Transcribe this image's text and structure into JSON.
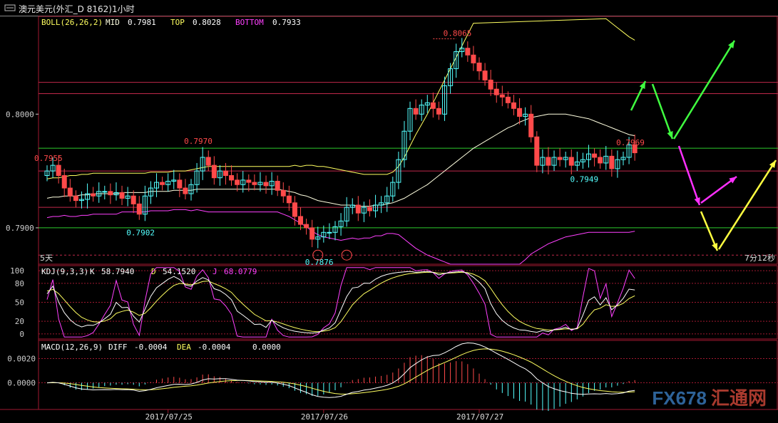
{
  "window": {
    "title": "澳元美元(外汇_D 8162)1小时",
    "title_icon": "chart-window-icon"
  },
  "watermark": {
    "brand": "FX678",
    "suffix": "汇通网",
    "logo_icon": "globe-logo-icon"
  },
  "colors": {
    "up": "#54ffff",
    "down": "#ff4a4a",
    "mid": "#ffffe0",
    "band": "#ffff60",
    "bottom": "#ff40ff",
    "grid_red": "#c0284a",
    "grid_green": "#2ccc2c",
    "arrow_green": "#40ff40",
    "arrow_magenta": "#ff30ff",
    "arrow_yellow": "#ffff40"
  },
  "chart_data": [
    {
      "type": "candlestick",
      "indicator_label": "BOLL(26,26,2)",
      "legend": [
        {
          "name": "MID",
          "value": "0.7981",
          "color": "#ffffe0"
        },
        {
          "name": "TOP",
          "value": "0.8028",
          "color": "#ffff60"
        },
        {
          "name": "BOTTOM",
          "value": "0.7933",
          "color": "#ff40ff"
        }
      ],
      "y_ticks": [
        "0.8000",
        "0.7900"
      ],
      "ylim": [
        0.7868,
        0.8086
      ],
      "x_ticks": [
        "2017/07/25",
        "2017/07/26",
        "2017/07/27"
      ],
      "period_label": "5天",
      "countdown": "7分12秒",
      "annotations": [
        {
          "text": "0.7955",
          "price": 0.7955,
          "candle": 0,
          "color": "#ff4a4a"
        },
        {
          "text": "0.7970",
          "price": 0.797,
          "candle": 26,
          "color": "#ff4a4a"
        },
        {
          "text": "0.7902",
          "price": 0.7902,
          "candle": 16,
          "color": "#54ffff"
        },
        {
          "text": "0.7876",
          "price": 0.7876,
          "candle": 47,
          "color": "#54ffff"
        },
        {
          "text": "0.8065",
          "price": 0.8065,
          "candle": 71,
          "color": "#ff4a4a"
        },
        {
          "text": "0.7949",
          "price": 0.7949,
          "candle": 93,
          "color": "#54ffff"
        },
        {
          "text": "0.7969",
          "price": 0.7969,
          "candle": 101,
          "color": "#ff4a4a"
        }
      ],
      "horizontal_levels": [
        {
          "price": 0.8028,
          "color": "red"
        },
        {
          "price": 0.8018,
          "color": "red"
        },
        {
          "price": 0.797,
          "color": "green"
        },
        {
          "price": 0.795,
          "color": "red"
        },
        {
          "price": 0.7918,
          "color": "red"
        },
        {
          "price": 0.79,
          "color": "green"
        },
        {
          "price": 0.7876,
          "color": "dashed"
        }
      ],
      "close": [
        0.795,
        0.7955,
        0.7946,
        0.7935,
        0.7928,
        0.7924,
        0.7925,
        0.793,
        0.7928,
        0.7932,
        0.7932,
        0.7929,
        0.7931,
        0.7926,
        0.7928,
        0.7921,
        0.7912,
        0.7928,
        0.7935,
        0.794,
        0.7938,
        0.7941,
        0.7942,
        0.7935,
        0.793,
        0.7938,
        0.795,
        0.7962,
        0.7955,
        0.7944,
        0.795,
        0.7946,
        0.7942,
        0.7938,
        0.7942,
        0.794,
        0.7938,
        0.794,
        0.7937,
        0.7941,
        0.7933,
        0.7928,
        0.7922,
        0.791,
        0.7903,
        0.79,
        0.789,
        0.7892,
        0.7896,
        0.7896,
        0.7901,
        0.7906,
        0.7918,
        0.792,
        0.7913,
        0.7918,
        0.7915,
        0.792,
        0.7922,
        0.7928,
        0.794,
        0.796,
        0.7985,
        0.8005,
        0.8,
        0.8008,
        0.801,
        0.8005,
        0.8,
        0.8025,
        0.804,
        0.8055,
        0.8058,
        0.8052,
        0.8045,
        0.8038,
        0.803,
        0.8022,
        0.8017,
        0.8015,
        0.801,
        0.8005,
        0.7998,
        0.8,
        0.798,
        0.7955,
        0.7962,
        0.7955,
        0.7962,
        0.796,
        0.7962,
        0.7955,
        0.7958,
        0.796,
        0.7965,
        0.7962,
        0.7957,
        0.7963,
        0.7952,
        0.796,
        0.7962,
        0.7973,
        0.7966
      ],
      "mid_line": [
        0.7926,
        0.7927,
        0.7927,
        0.7928,
        0.7928,
        0.7928,
        0.7929,
        0.7929,
        0.793,
        0.793,
        0.793,
        0.793,
        0.793,
        0.7931,
        0.7931,
        0.7931,
        0.7931,
        0.7931,
        0.7932,
        0.7932,
        0.7932,
        0.7932,
        0.7933,
        0.7933,
        0.7933,
        0.7933,
        0.7934,
        0.7934,
        0.7934,
        0.7934,
        0.7934,
        0.7934,
        0.7934,
        0.7934,
        0.7934,
        0.7934,
        0.7934,
        0.7934,
        0.7934,
        0.7934,
        0.7934,
        0.7933,
        0.7932,
        0.7931,
        0.7929,
        0.7928,
        0.7926,
        0.7924,
        0.7923,
        0.7922,
        0.7921,
        0.792,
        0.792,
        0.792,
        0.7919,
        0.7919,
        0.7919,
        0.792,
        0.792,
        0.7921,
        0.7922,
        0.7924,
        0.7926,
        0.7929,
        0.7932,
        0.7935,
        0.7938,
        0.7942,
        0.7946,
        0.795,
        0.7954,
        0.7958,
        0.7962,
        0.7966,
        0.797,
        0.7973,
        0.7976,
        0.7979,
        0.7982,
        0.7985,
        0.7988,
        0.799,
        0.7993,
        0.7995,
        0.7997,
        0.7998,
        0.7999,
        0.8,
        0.8,
        0.8,
        0.8,
        0.7999,
        0.7998,
        0.7997,
        0.7996,
        0.7994,
        0.7992,
        0.799,
        0.7988,
        0.7986,
        0.7984,
        0.7982,
        0.7981
      ]
    },
    {
      "type": "line",
      "indicator_label": "KDJ(9,3,3)",
      "legend": [
        {
          "name": "K",
          "value": "58.7940",
          "color": "#ffffff"
        },
        {
          "name": "D",
          "value": "54.1520",
          "color": "#ffff60"
        },
        {
          "name": "J",
          "value": "68.0779",
          "color": "#ff40ff"
        }
      ],
      "y_ticks": [
        "100",
        "80",
        "50",
        "20",
        "0"
      ],
      "ylim": [
        -8,
        108
      ]
    },
    {
      "type": "bar",
      "indicator_label": "MACD(12,26,9)",
      "legend": [
        {
          "name": "DIFF",
          "value": "-0.0004",
          "color": "#ffffff"
        },
        {
          "name": "DEA",
          "value": "-0.0004",
          "color": "#ffff60"
        },
        {
          "name": "",
          "value": "0.0000",
          "color": "#ffffff"
        }
      ],
      "y_ticks": [
        "0.0020",
        "0.0000"
      ],
      "ylim": [
        -0.0022,
        0.0035
      ]
    }
  ]
}
